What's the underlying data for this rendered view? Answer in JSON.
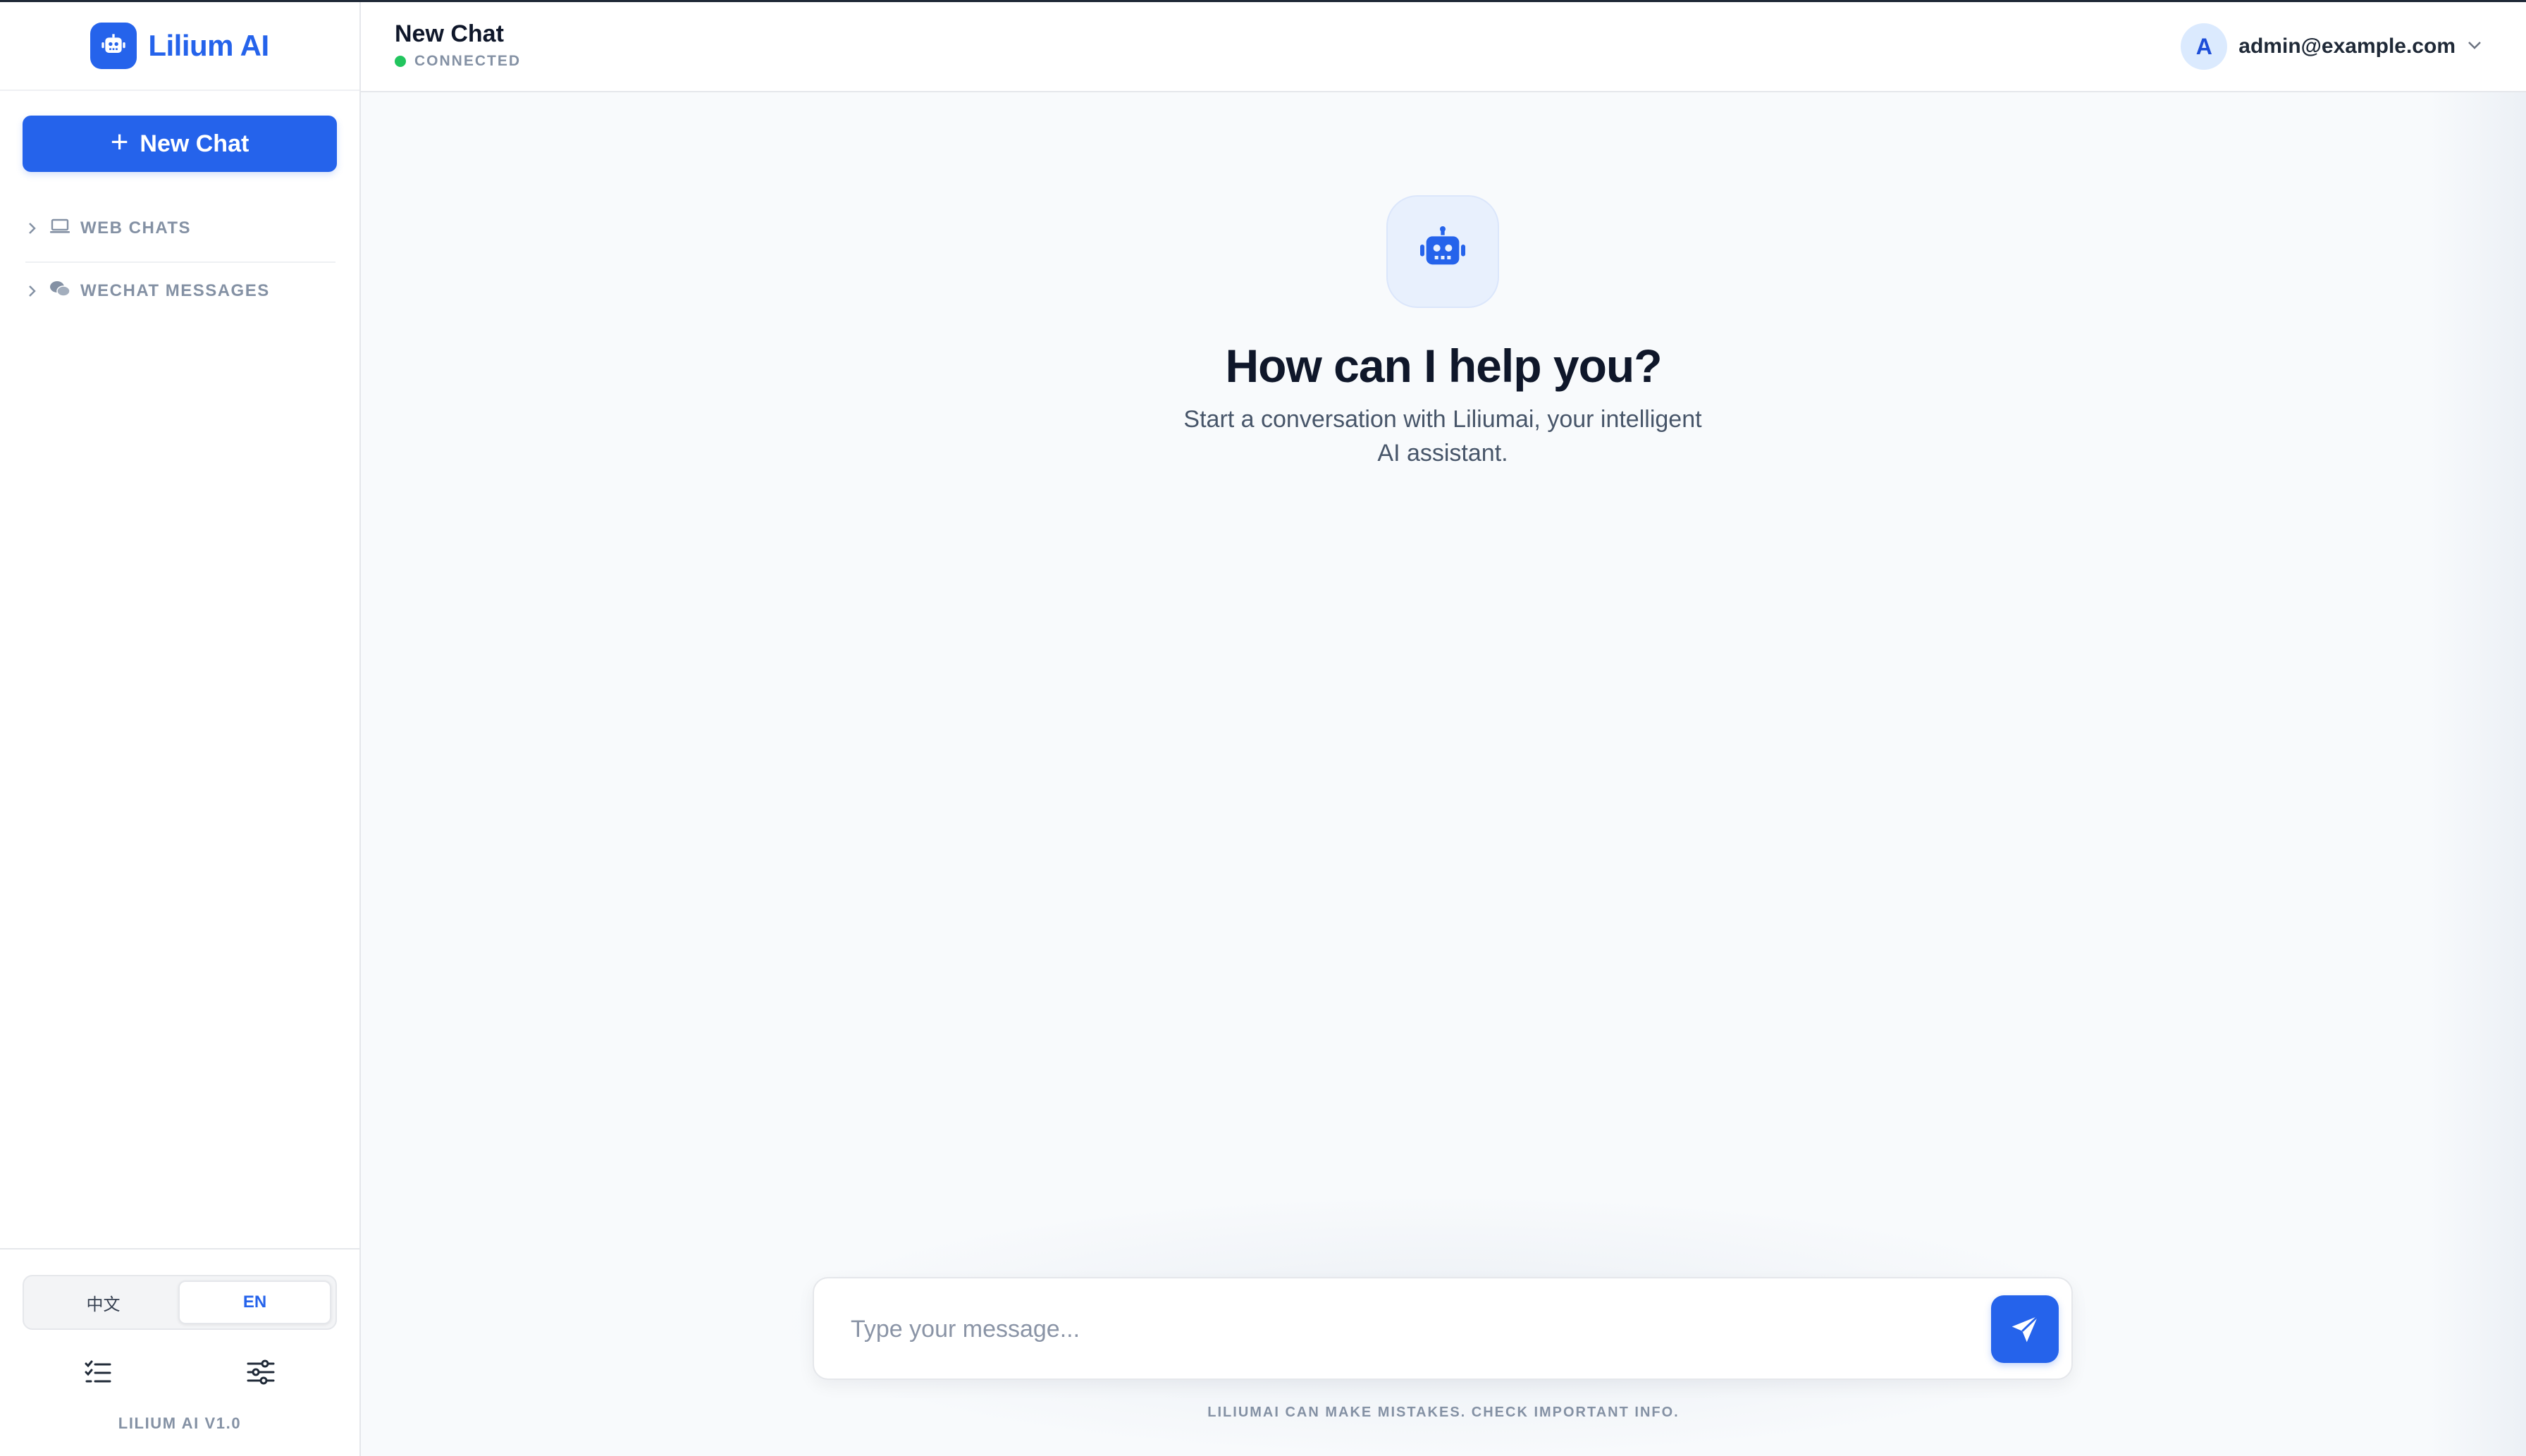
{
  "app": {
    "name": "Lilium AI",
    "version": "LILIUM AI V1.0"
  },
  "sidebar": {
    "new_chat_label": "New Chat",
    "groups": [
      {
        "label": "WEB CHATS",
        "icon": "laptop-icon"
      },
      {
        "label": "WECHAT MESSAGES",
        "icon": "wechat-icon"
      }
    ],
    "languages": [
      {
        "label": "中文",
        "active": false
      },
      {
        "label": "EN",
        "active": true
      }
    ],
    "tools": [
      "task-list-icon",
      "sliders-icon"
    ]
  },
  "header": {
    "title": "New Chat",
    "status": "CONNECTED",
    "user": {
      "initial": "A",
      "email": "admin@example.com"
    }
  },
  "main": {
    "hero_title": "How can I help you?",
    "hero_subtitle": "Start a conversation with Liliumai, your intelligent AI assistant.",
    "composer_placeholder": "Type your message...",
    "disclaimer": "LILIUMAI CAN MAKE MISTAKES. CHECK IMPORTANT INFO."
  },
  "colors": {
    "accent": "#2563eb",
    "status_connected": "#22c55e",
    "muted_text": "#8491a4",
    "background": "#f8fafc"
  }
}
